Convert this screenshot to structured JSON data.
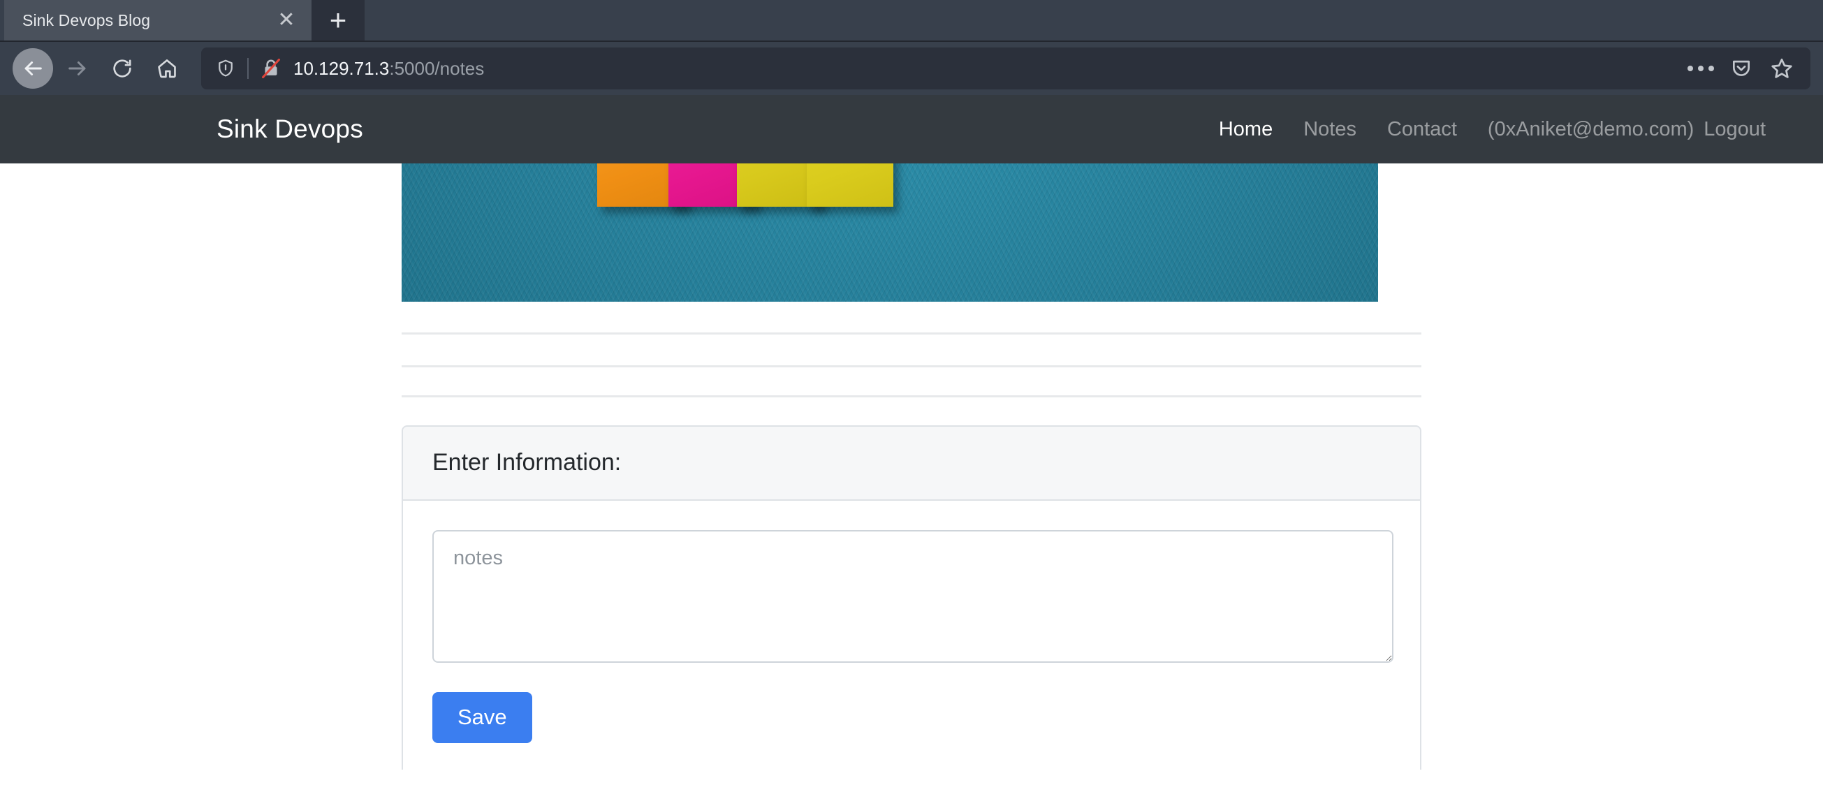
{
  "browser": {
    "tab": {
      "title": "Sink Devops Blog",
      "close_icon": "close-icon",
      "newtab_icon": "plus-icon"
    },
    "toolbar": {
      "back_icon": "back-arrow-icon",
      "forward_icon": "forward-arrow-icon",
      "reload_icon": "reload-icon",
      "home_icon": "home-icon",
      "shield_icon": "shield-icon",
      "lock_icon": "insecure-padlock-icon",
      "page_actions_icon": "ellipsis-icon",
      "pocket_icon": "pocket-icon",
      "bookmark_icon": "star-icon",
      "url_host": "10.129.71.3",
      "url_path": ":5000/notes"
    }
  },
  "site": {
    "brand": "Sink Devops",
    "nav": [
      {
        "label": "Home",
        "active": true
      },
      {
        "label": "Notes",
        "active": false
      },
      {
        "label": "Contact",
        "active": false
      }
    ],
    "user": "(0xAniket@demo.com)",
    "logout": "Logout"
  },
  "hero": {
    "alt": "sticky-notes-on-teal-wall",
    "sticky_colors": [
      "#f08f14",
      "#e6178f",
      "#d8c91c",
      "#dacc1d"
    ],
    "wall_color": "#247e99"
  },
  "form": {
    "header": "Enter Information:",
    "textarea_placeholder": "notes",
    "textarea_value": "",
    "save_label": "Save",
    "save_color": "#3b7ef0"
  }
}
